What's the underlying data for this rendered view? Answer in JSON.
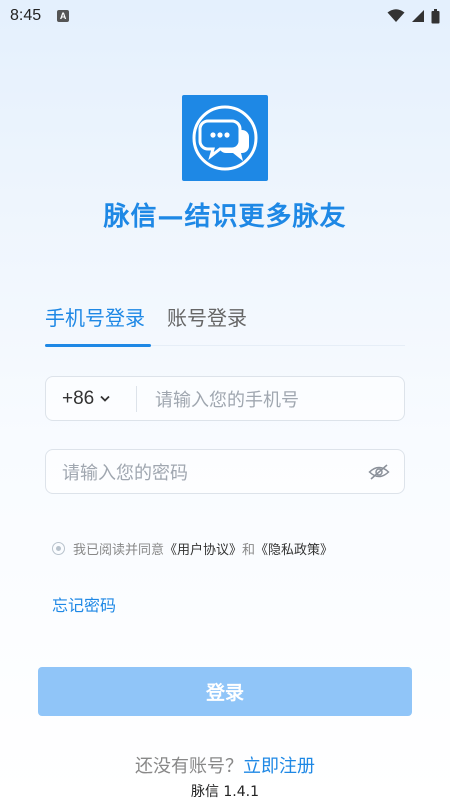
{
  "status_bar": {
    "time": "8:45",
    "notification_icon_letter": "A",
    "icons": [
      "wifi-icon",
      "signal-icon",
      "battery-icon"
    ]
  },
  "app": {
    "title": "脉信—结识更多脉友",
    "brand_color": "#1e88e5",
    "logo_icon": "chat-bubbles-icon"
  },
  "tabs": [
    {
      "label": "手机号登录",
      "active": true
    },
    {
      "label": "账号登录",
      "active": false
    }
  ],
  "phone_field": {
    "country_code": "+86",
    "placeholder": "请输入您的手机号"
  },
  "password_field": {
    "placeholder": "请输入您的密码",
    "toggle_icon": "eye-off-icon"
  },
  "agreement": {
    "prefix": "我已阅读并同意",
    "user_agreement": "《用户协议》",
    "and": "和",
    "privacy_policy": "《隐私政策》"
  },
  "forgot_password": "忘记密码",
  "login_button": "登录",
  "register": {
    "prompt": "还没有账号？",
    "link": "立即注册"
  },
  "version": "脉信 1.4.1"
}
